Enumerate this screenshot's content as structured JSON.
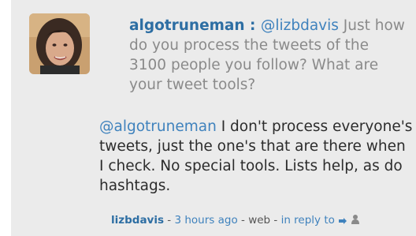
{
  "quoted_tweet": {
    "author": "algotruneman",
    "separator": " : ",
    "mention": "@lizbdavis",
    "text": " Just how do you process the tweets of the 3100 people you follow? What are your tweet tools?"
  },
  "reply_tweet": {
    "mention": "@algotruneman",
    "text": " I don't process everyone's tweets, just the one's that are there when I check. No special tools. Lists help, as do hashtags."
  },
  "meta": {
    "username": "lizbdavis",
    "sep1": " - ",
    "time": "3 hours ago",
    "sep2": " - ",
    "source": "web",
    "sep3": " - ",
    "in_reply_to": "in reply to",
    "reply_icon": "pointing-hand-icon",
    "user_icon": "person-icon"
  },
  "colors": {
    "background": "#ebebeb",
    "link": "#3f82bd",
    "username": "#2d6ea3",
    "quoted_text": "#8a8a8a",
    "body_text": "#2c2c2c"
  }
}
